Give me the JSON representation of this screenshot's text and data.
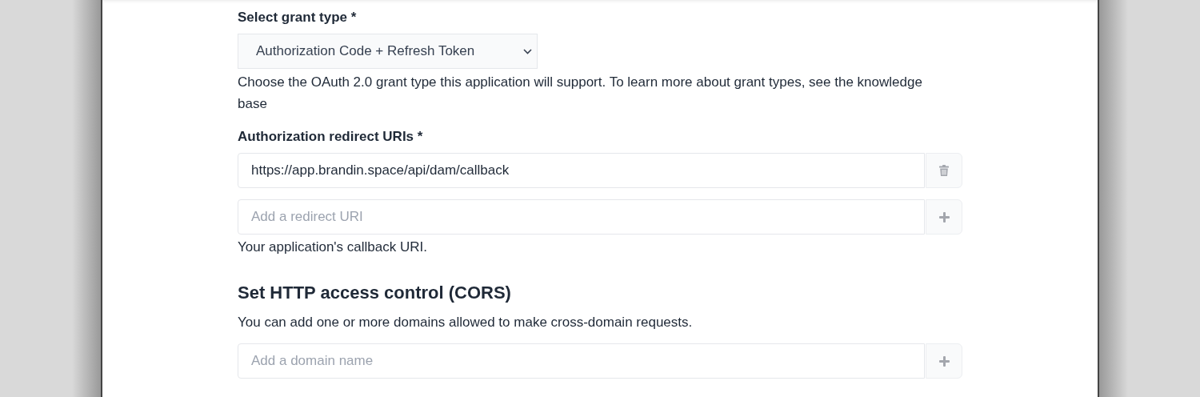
{
  "grant_type": {
    "label": "Select grant type *",
    "value": "Authorization Code + Refresh Token",
    "help": "Choose the OAuth 2.0 grant type this application will support. To learn more about grant types, see the knowledge base"
  },
  "redirect_uris": {
    "label": "Authorization redirect URIs *",
    "rows": [
      {
        "value": "https://app.brandin.space/api/dam/callback",
        "kind": "delete"
      },
      {
        "placeholder": "Add a redirect URI",
        "kind": "add"
      }
    ],
    "help": "Your application's callback URI."
  },
  "cors": {
    "heading": "Set HTTP access control (CORS)",
    "description": "You can add one or more domains allowed to make cross-domain requests.",
    "rows": [
      {
        "placeholder": "Add a domain name",
        "kind": "add"
      }
    ]
  }
}
